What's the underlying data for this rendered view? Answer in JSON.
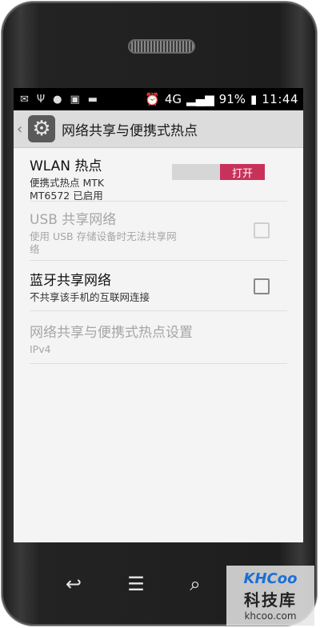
{
  "status_bar": {
    "network": "4G",
    "battery": "91%",
    "time": "11:44"
  },
  "action_bar": {
    "title": "网络共享与便携式热点"
  },
  "settings": {
    "wlan_hotspot": {
      "title": "WLAN 热点",
      "subtitle_line1": "便携式热点 MTK",
      "subtitle_line2": "MT6572 已启用",
      "toggle_label": "打开"
    },
    "usb_tethering": {
      "title": "USB 共享网络",
      "subtitle_line1": "使用 USB 存储设备时无法共享网",
      "subtitle_line2": "络"
    },
    "bluetooth_tethering": {
      "title": "蓝牙共享网络",
      "subtitle": "不共享该手机的互联网连接"
    },
    "hotspot_settings": {
      "title": "网络共享与便携式热点设置",
      "subtitle": "IPv4"
    }
  },
  "watermark": {
    "logo": "KHCoo",
    "name": "科技库",
    "url": "khcoo.com"
  },
  "colors": {
    "toggle_on": "#c8325a",
    "status_bar_bg": "#000000",
    "action_bar_bg": "#dcdcdc",
    "screen_bg": "#f4f4f4"
  }
}
